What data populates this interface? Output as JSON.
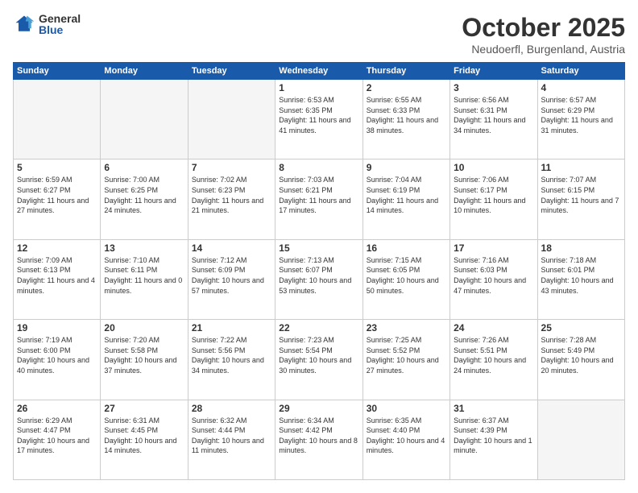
{
  "logo": {
    "general": "General",
    "blue": "Blue"
  },
  "header": {
    "month": "October 2025",
    "location": "Neudoerfl, Burgenland, Austria"
  },
  "weekdays": [
    "Sunday",
    "Monday",
    "Tuesday",
    "Wednesday",
    "Thursday",
    "Friday",
    "Saturday"
  ],
  "weeks": [
    [
      {
        "day": "",
        "info": ""
      },
      {
        "day": "",
        "info": ""
      },
      {
        "day": "",
        "info": ""
      },
      {
        "day": "1",
        "info": "Sunrise: 6:53 AM\nSunset: 6:35 PM\nDaylight: 11 hours\nand 41 minutes."
      },
      {
        "day": "2",
        "info": "Sunrise: 6:55 AM\nSunset: 6:33 PM\nDaylight: 11 hours\nand 38 minutes."
      },
      {
        "day": "3",
        "info": "Sunrise: 6:56 AM\nSunset: 6:31 PM\nDaylight: 11 hours\nand 34 minutes."
      },
      {
        "day": "4",
        "info": "Sunrise: 6:57 AM\nSunset: 6:29 PM\nDaylight: 11 hours\nand 31 minutes."
      }
    ],
    [
      {
        "day": "5",
        "info": "Sunrise: 6:59 AM\nSunset: 6:27 PM\nDaylight: 11 hours\nand 27 minutes."
      },
      {
        "day": "6",
        "info": "Sunrise: 7:00 AM\nSunset: 6:25 PM\nDaylight: 11 hours\nand 24 minutes."
      },
      {
        "day": "7",
        "info": "Sunrise: 7:02 AM\nSunset: 6:23 PM\nDaylight: 11 hours\nand 21 minutes."
      },
      {
        "day": "8",
        "info": "Sunrise: 7:03 AM\nSunset: 6:21 PM\nDaylight: 11 hours\nand 17 minutes."
      },
      {
        "day": "9",
        "info": "Sunrise: 7:04 AM\nSunset: 6:19 PM\nDaylight: 11 hours\nand 14 minutes."
      },
      {
        "day": "10",
        "info": "Sunrise: 7:06 AM\nSunset: 6:17 PM\nDaylight: 11 hours\nand 10 minutes."
      },
      {
        "day": "11",
        "info": "Sunrise: 7:07 AM\nSunset: 6:15 PM\nDaylight: 11 hours\nand 7 minutes."
      }
    ],
    [
      {
        "day": "12",
        "info": "Sunrise: 7:09 AM\nSunset: 6:13 PM\nDaylight: 11 hours\nand 4 minutes."
      },
      {
        "day": "13",
        "info": "Sunrise: 7:10 AM\nSunset: 6:11 PM\nDaylight: 11 hours\nand 0 minutes."
      },
      {
        "day": "14",
        "info": "Sunrise: 7:12 AM\nSunset: 6:09 PM\nDaylight: 10 hours\nand 57 minutes."
      },
      {
        "day": "15",
        "info": "Sunrise: 7:13 AM\nSunset: 6:07 PM\nDaylight: 10 hours\nand 53 minutes."
      },
      {
        "day": "16",
        "info": "Sunrise: 7:15 AM\nSunset: 6:05 PM\nDaylight: 10 hours\nand 50 minutes."
      },
      {
        "day": "17",
        "info": "Sunrise: 7:16 AM\nSunset: 6:03 PM\nDaylight: 10 hours\nand 47 minutes."
      },
      {
        "day": "18",
        "info": "Sunrise: 7:18 AM\nSunset: 6:01 PM\nDaylight: 10 hours\nand 43 minutes."
      }
    ],
    [
      {
        "day": "19",
        "info": "Sunrise: 7:19 AM\nSunset: 6:00 PM\nDaylight: 10 hours\nand 40 minutes."
      },
      {
        "day": "20",
        "info": "Sunrise: 7:20 AM\nSunset: 5:58 PM\nDaylight: 10 hours\nand 37 minutes."
      },
      {
        "day": "21",
        "info": "Sunrise: 7:22 AM\nSunset: 5:56 PM\nDaylight: 10 hours\nand 34 minutes."
      },
      {
        "day": "22",
        "info": "Sunrise: 7:23 AM\nSunset: 5:54 PM\nDaylight: 10 hours\nand 30 minutes."
      },
      {
        "day": "23",
        "info": "Sunrise: 7:25 AM\nSunset: 5:52 PM\nDaylight: 10 hours\nand 27 minutes."
      },
      {
        "day": "24",
        "info": "Sunrise: 7:26 AM\nSunset: 5:51 PM\nDaylight: 10 hours\nand 24 minutes."
      },
      {
        "day": "25",
        "info": "Sunrise: 7:28 AM\nSunset: 5:49 PM\nDaylight: 10 hours\nand 20 minutes."
      }
    ],
    [
      {
        "day": "26",
        "info": "Sunrise: 6:29 AM\nSunset: 4:47 PM\nDaylight: 10 hours\nand 17 minutes."
      },
      {
        "day": "27",
        "info": "Sunrise: 6:31 AM\nSunset: 4:45 PM\nDaylight: 10 hours\nand 14 minutes."
      },
      {
        "day": "28",
        "info": "Sunrise: 6:32 AM\nSunset: 4:44 PM\nDaylight: 10 hours\nand 11 minutes."
      },
      {
        "day": "29",
        "info": "Sunrise: 6:34 AM\nSunset: 4:42 PM\nDaylight: 10 hours\nand 8 minutes."
      },
      {
        "day": "30",
        "info": "Sunrise: 6:35 AM\nSunset: 4:40 PM\nDaylight: 10 hours\nand 4 minutes."
      },
      {
        "day": "31",
        "info": "Sunrise: 6:37 AM\nSunset: 4:39 PM\nDaylight: 10 hours\nand 1 minute."
      },
      {
        "day": "",
        "info": ""
      }
    ]
  ]
}
